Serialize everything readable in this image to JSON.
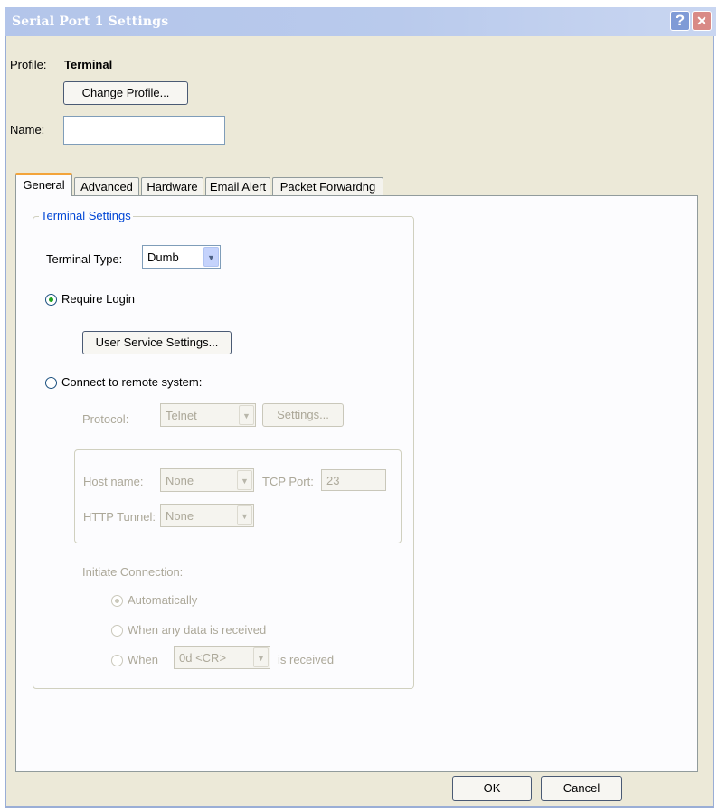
{
  "window": {
    "title": "Serial Port 1 Settings",
    "help_glyph": "?",
    "close_glyph": "✕"
  },
  "profile": {
    "label": "Profile:",
    "value": "Terminal",
    "change_button": "Change Profile..."
  },
  "name_field": {
    "label": "Name:",
    "value": "",
    "placeholder": ""
  },
  "tabs": [
    {
      "label": "General",
      "active": true
    },
    {
      "label": "Advanced",
      "active": false
    },
    {
      "label": "Hardware",
      "active": false
    },
    {
      "label": "Email Alert",
      "active": false
    },
    {
      "label": "Packet Forwardng",
      "active": false
    }
  ],
  "terminal_settings": {
    "group_title": "Terminal Settings",
    "terminal_type_label": "Terminal Type:",
    "terminal_type_value": "Dumb",
    "require_login_label": "Require Login",
    "require_login_selected": true,
    "user_service_button": "User Service Settings...",
    "connect_remote_label": "Connect to remote system:",
    "connect_remote_selected": false,
    "protocol_label": "Protocol:",
    "protocol_value": "Telnet",
    "settings_button": "Settings...",
    "host_name_label": "Host name:",
    "host_name_value": "None",
    "tcp_port_label": "TCP Port:",
    "tcp_port_value": "23",
    "http_tunnel_label": "HTTP Tunnel:",
    "http_tunnel_value": "None",
    "initiate_label": "Initiate Connection:",
    "automatically_label": "Automatically",
    "any_data_label": "When any data is received",
    "when_label": "When",
    "when_value": "0d <CR>",
    "is_received_label": "is received"
  },
  "footer": {
    "ok_button": "OK",
    "cancel_button": "Cancel"
  },
  "colors": {
    "titlebar": "#b3c5ea",
    "dialog_bg": "#ece9d8",
    "active_tab_accent": "#f3a43b",
    "group_title": "#0046d5",
    "radio_dot": "#21a121"
  }
}
